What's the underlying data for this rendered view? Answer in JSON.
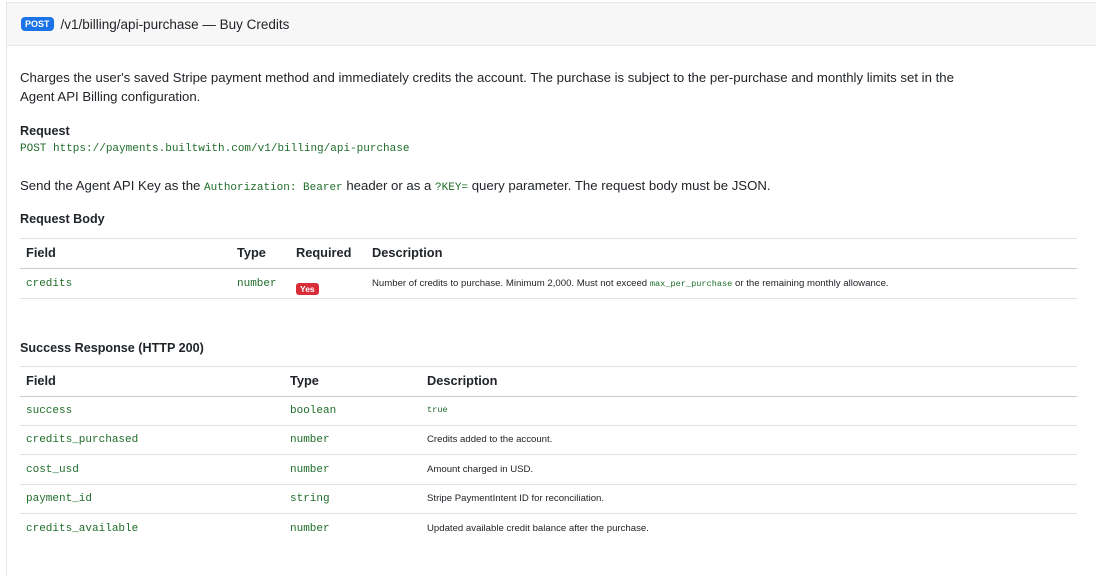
{
  "header": {
    "method": "POST",
    "title": "/v1/billing/api-purchase — Buy Credits"
  },
  "intro": {
    "line1": "Charges the user's saved Stripe payment method and immediately credits the account. The purchase is subject to the per-purchase and monthly limits set in the",
    "line2": "Agent API Billing configuration."
  },
  "request": {
    "heading": "Request",
    "url": "POST https://payments.builtwith.com/v1/billing/api-purchase"
  },
  "auth_note": {
    "prefix": "Send the Agent API Key as the ",
    "code1": "Authorization: Bearer",
    "middle": " header or as a ",
    "code2": "?KEY=",
    "suffix": " query parameter. The request body must be JSON."
  },
  "request_body": {
    "heading": "Request Body",
    "columns": [
      "Field",
      "Type",
      "Required",
      "Description"
    ],
    "rows": [
      {
        "field": "credits",
        "type": "number",
        "required": "Yes",
        "desc_prefix": "Number of credits to purchase. Minimum 2,000. Must not exceed ",
        "desc_code": "max_per_purchase",
        "desc_suffix": " or the remaining monthly allowance."
      }
    ]
  },
  "success_response": {
    "heading": "Success Response (HTTP 200)",
    "columns": [
      "Field",
      "Type",
      "Description"
    ],
    "rows": [
      {
        "field": "success",
        "type": "boolean",
        "desc": "true",
        "desc_is_code": true
      },
      {
        "field": "credits_purchased",
        "type": "number",
        "desc": "Credits added to the account."
      },
      {
        "field": "cost_usd",
        "type": "number",
        "desc": "Amount charged in USD."
      },
      {
        "field": "payment_id",
        "type": "string",
        "desc": "Stripe PaymentIntent ID for reconciliation."
      },
      {
        "field": "credits_available",
        "type": "number",
        "desc": "Updated available credit balance after the purchase."
      }
    ]
  },
  "colors": {
    "accent": "#1a73e8",
    "code": "#1f6d2a",
    "required_badge": "#d92d3a"
  }
}
